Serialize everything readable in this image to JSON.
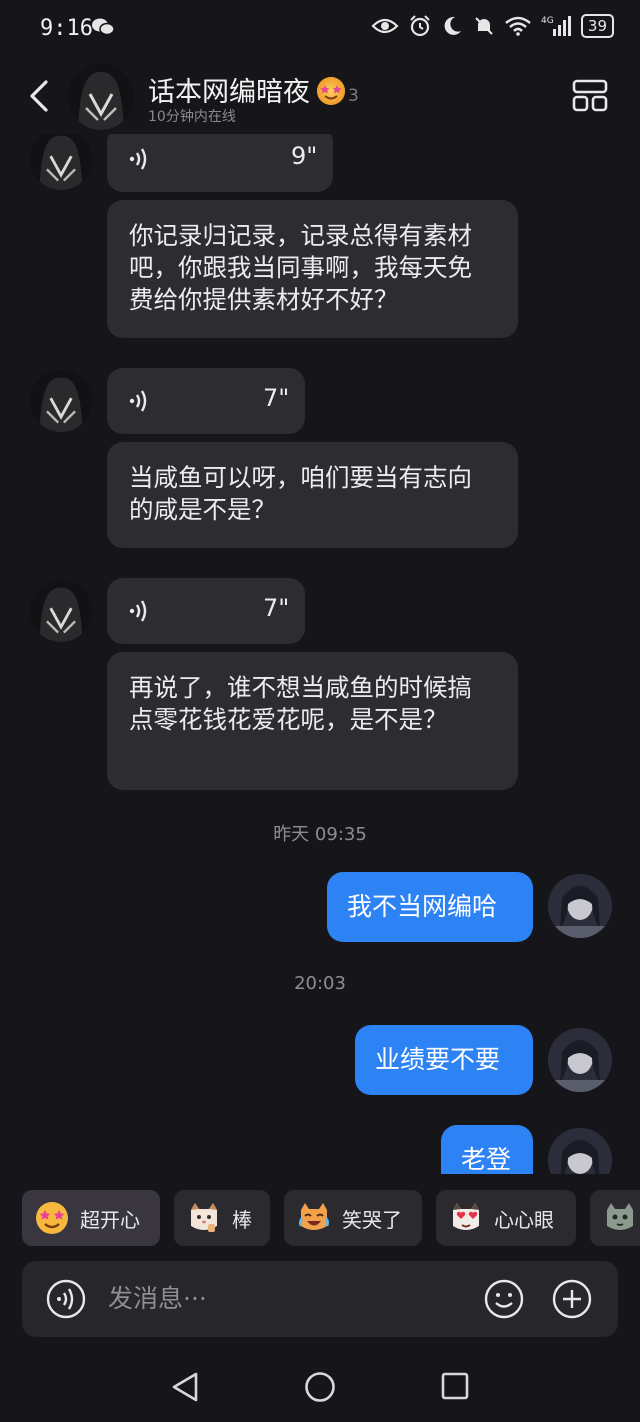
{
  "status_bar": {
    "time": "9:16",
    "battery": "39",
    "network": "4G"
  },
  "header": {
    "name": "话本网编暗夜",
    "badge_count": "3",
    "online_status": "10分钟内在线"
  },
  "messages": {
    "voice_1_duration": "9\"",
    "text_1": "你记录归记录，记录总得有素材吧，你跟我当同事啊，我每天免费给你提供素材好不好？",
    "voice_2_duration": "7\"",
    "text_2": "当咸鱼可以呀，咱们要当有志向的咸是不是？",
    "voice_3_duration": "7\"",
    "text_3": "再说了，谁不想当咸鱼的时候搞点零花钱花爱花呢，是不是？",
    "timestamp_1": "昨天 09:35",
    "out_1": "我不当网编哈",
    "timestamp_2": "20:03",
    "out_2": "业绩要不要",
    "out_3": "老登"
  },
  "quick_replies": [
    {
      "label": "超开心",
      "icon": "star-eyes-emoji"
    },
    {
      "label": "棒",
      "icon": "cat-thumbs-up-emoji"
    },
    {
      "label": "笑哭了",
      "icon": "cat-laugh-cry-emoji"
    },
    {
      "label": "心心眼",
      "icon": "cat-heart-eyes-emoji"
    },
    {
      "label": "",
      "icon": "cat-emoji"
    }
  ],
  "input": {
    "placeholder": "发消息···"
  },
  "colors": {
    "background": "#16161a",
    "bubble_incoming": "#2c2c31",
    "bubble_outgoing": "#2e83f4"
  }
}
